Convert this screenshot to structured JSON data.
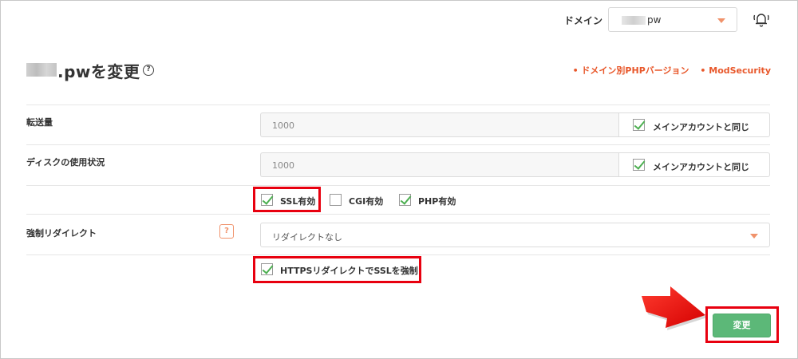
{
  "header": {
    "domain_label": "ドメイン",
    "domain_value": "pw"
  },
  "title": {
    "text": ".pwを変更",
    "help": "?"
  },
  "links": {
    "php": "• ドメイン別PHPバージョン",
    "modsecurity": "• ModSecurity"
  },
  "transfer": {
    "label": "転送量",
    "value": "1000",
    "same_label": "メインアカウントと同じ"
  },
  "disk": {
    "label": "ディスクの使用状況",
    "value": "1000",
    "same_label": "メインアカウントと同じ"
  },
  "features": {
    "ssl": "SSL有効",
    "cgi": "CGI有効",
    "php": "PHP有効"
  },
  "redirect": {
    "label": "強制リダイレクト",
    "help": "?",
    "selected": "リダイレクトなし",
    "https_label": "HTTPSリダイレクトでSSLを強制"
  },
  "actions": {
    "submit": "変更"
  },
  "colors": {
    "accent": "#e8572a",
    "submit_green": "#5cb878",
    "highlight_red": "#e8000f"
  }
}
